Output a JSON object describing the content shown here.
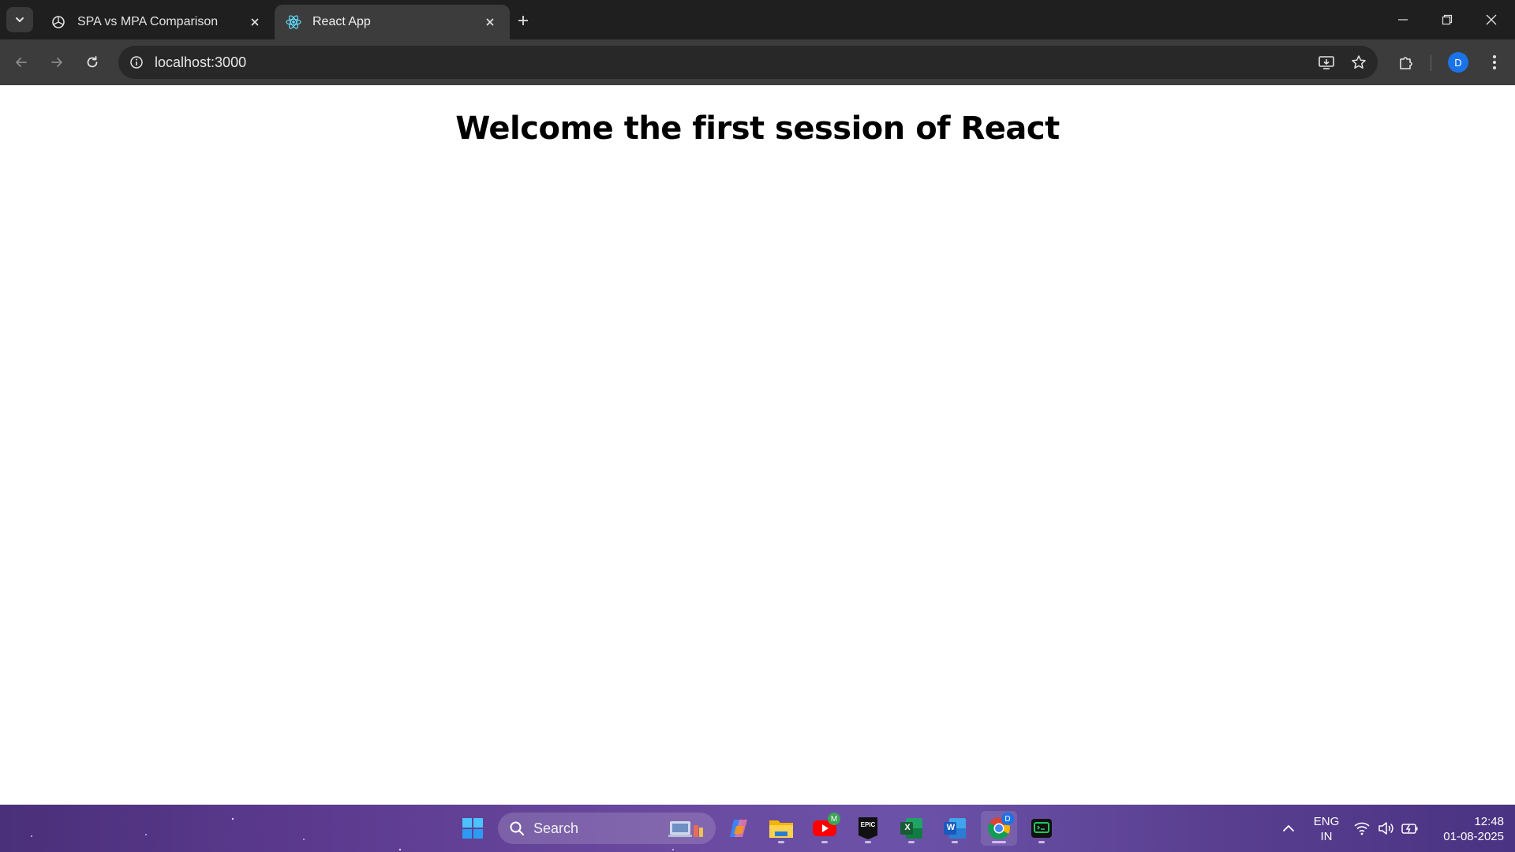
{
  "browser": {
    "tabs": [
      {
        "title": "SPA vs MPA Comparison",
        "icon": "chatgpt-icon",
        "active": false
      },
      {
        "title": "React App",
        "icon": "react-icon",
        "active": true
      }
    ],
    "address_bar": {
      "url": "localhost:3000"
    },
    "profile_initial": "D"
  },
  "page": {
    "heading": "Welcome the first session of React"
  },
  "taskbar": {
    "search_label": "Search",
    "apps": [
      "windows-start-icon",
      "copilot-icon",
      "file-explorer-icon",
      "youtube-icon",
      "epic-games-icon",
      "excel-icon",
      "word-icon",
      "chrome-icon",
      "terminal-icon"
    ],
    "youtube_badge": "M",
    "chrome_badge": "D",
    "epic_label": "EPIC",
    "excel_letter": "X",
    "word_letter": "W",
    "language": {
      "line1": "ENG",
      "line2": "IN"
    },
    "clock": {
      "time": "12:48",
      "date": "01-08-2025"
    }
  },
  "colors": {
    "tab_strip": "#1f1f1f",
    "toolbar": "#3c3c3c",
    "omnibox": "#282828",
    "avatar": "#1a73e8",
    "taskbar_accent": "#6a4aa0"
  }
}
